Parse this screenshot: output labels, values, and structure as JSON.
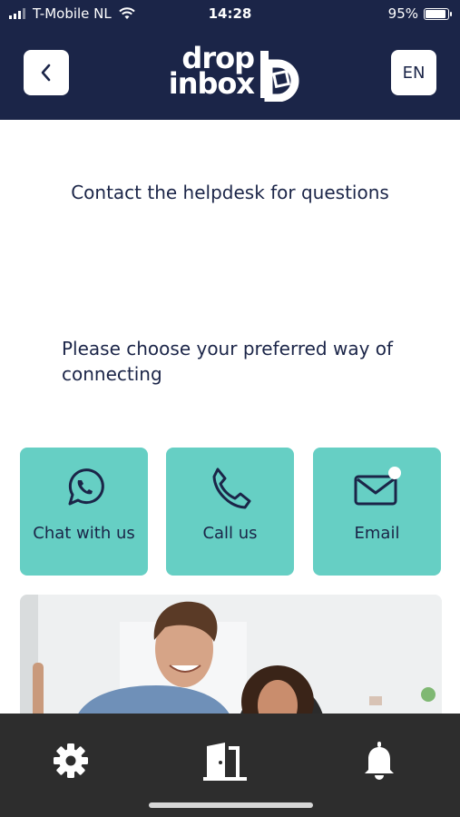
{
  "status_bar": {
    "carrier": "T-Mobile NL",
    "time": "14:28",
    "battery_text": "95%",
    "battery_level": 0.95
  },
  "header": {
    "logo_line1": "drop",
    "logo_line2": "inbox",
    "logo_mark": "b",
    "language": "EN",
    "back_icon": "chevron-left-icon"
  },
  "main": {
    "heading": "Contact the helpdesk for questions",
    "subheading": "Please choose your preferred way of connecting",
    "options": [
      {
        "label": "Chat with us",
        "icon": "whatsapp-icon"
      },
      {
        "label": "Call us",
        "icon": "phone-icon"
      },
      {
        "label": "Email",
        "icon": "envelope-icon"
      }
    ]
  },
  "tabbar": {
    "items": [
      {
        "icon": "gear-icon"
      },
      {
        "icon": "door-icon"
      },
      {
        "icon": "bell-icon"
      }
    ]
  },
  "colors": {
    "header_bg": "#1b2548",
    "accent": "#66cfc4",
    "text": "#1b2548",
    "tabbar_bg": "#2d2d2d"
  }
}
